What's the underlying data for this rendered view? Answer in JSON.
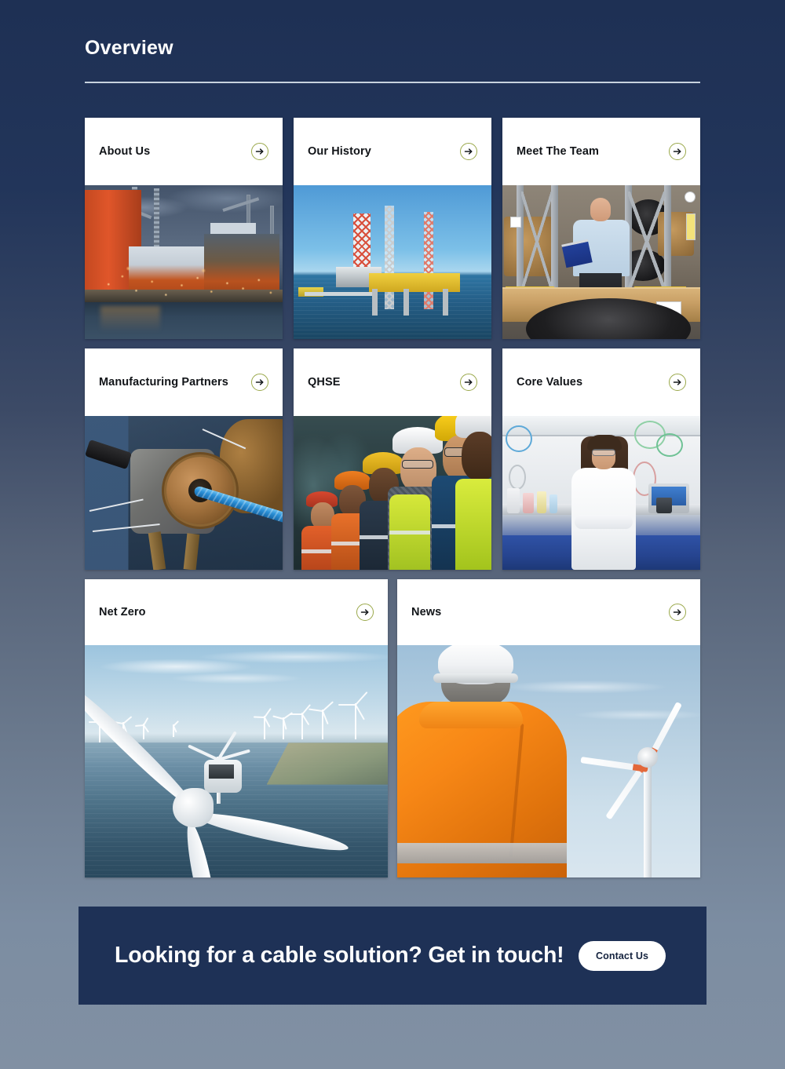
{
  "page": {
    "background_top_color": "#1e3054",
    "background_bottom_color": "#8190a3"
  },
  "header": {
    "title": "Overview"
  },
  "cards": [
    {
      "title": "About Us",
      "arrow_icon": "arrow-right-circle-icon",
      "image_alt": "Offshore oil rigs and ships at a shipyard at dusk"
    },
    {
      "title": "Our History",
      "arrow_icon": "arrow-right-circle-icon",
      "image_alt": "Jack-up drilling rig at sea under a blue sky"
    },
    {
      "title": "Meet The Team",
      "arrow_icon": "arrow-right-circle-icon",
      "image_alt": "Man with clipboard in a cable warehouse"
    },
    {
      "title": "Manufacturing Partners",
      "arrow_icon": "arrow-right-circle-icon",
      "image_alt": "Cable extrusion machinery producing blue cable"
    },
    {
      "title": "QHSE",
      "arrow_icon": "arrow-right-circle-icon",
      "image_alt": "Row of workers in hard hats and hi-vis vests"
    },
    {
      "title": "Core Values",
      "arrow_icon": "arrow-right-circle-icon",
      "image_alt": "Scientist in white lab coat in a laboratory"
    },
    {
      "title": "Net Zero",
      "arrow_icon": "arrow-right-circle-icon",
      "image_alt": "Aerial view of an offshore wind farm"
    },
    {
      "title": "News",
      "arrow_icon": "arrow-right-circle-icon",
      "image_alt": "Worker in orange hi-vis looking at a wind turbine"
    }
  ],
  "cta": {
    "text": "Looking for a cable solution? Get in touch!",
    "button_label": "Contact Us",
    "background_color": "#1e3156",
    "button_background_color": "#ffffff"
  },
  "theme": {
    "card_background": "#ffffff",
    "card_title_color": "#111418",
    "arrow_circle_color": "#9aa84a",
    "header_rule_color": "#c7d2de"
  }
}
